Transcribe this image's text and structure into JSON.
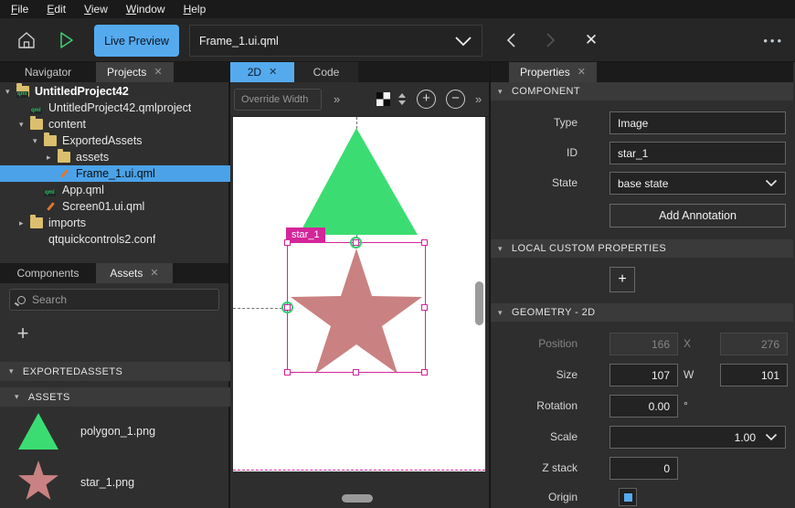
{
  "icons": {
    "caret_down": "▾",
    "caret_right": "▸",
    "close": "✕",
    "chevrons_right": "»",
    "ellipsis": "•••",
    "plus": "+",
    "minus": "−",
    "degree": "°"
  },
  "colors": {
    "accent_blue": "#55aaee",
    "selection_magenta": "#d4259a",
    "triangle_green": "#3bdd72",
    "star_rose": "#ca8181",
    "origin_blue": "#55aaee"
  },
  "menubar": {
    "items": [
      "File",
      "Edit",
      "View",
      "Window",
      "Help"
    ]
  },
  "topbar": {
    "live_preview_label": "Live Preview",
    "open_file": "Frame_1.ui.qml"
  },
  "left": {
    "tabs": {
      "navigator": "Navigator",
      "projects": "Projects"
    },
    "tree": {
      "qml_badge": "qml",
      "items": [
        {
          "label": "UntitledProject42"
        },
        {
          "label": "UntitledProject42.qmlproject"
        },
        {
          "label": "content"
        },
        {
          "label": "ExportedAssets"
        },
        {
          "label": "assets"
        },
        {
          "label": "Frame_1.ui.qml"
        },
        {
          "label": "App.qml"
        },
        {
          "label": "Screen01.ui.qml"
        },
        {
          "label": "imports"
        },
        {
          "label": "qtquickcontrols2.conf"
        }
      ]
    },
    "tabs2": {
      "components": "Components",
      "assets": "Assets"
    },
    "search": {
      "placeholder": "Search"
    },
    "sections": {
      "exported_assets": "EXPORTEDASSETS",
      "assets": "ASSETS"
    },
    "asset_files": [
      {
        "name": "polygon_1.png"
      },
      {
        "name": "star_1.png"
      }
    ]
  },
  "center": {
    "tabs": {
      "two_d": "2D",
      "code": "Code"
    },
    "toolbar": {
      "override_width_placeholder": "Override Width"
    },
    "canvas": {
      "selection_label": "star_1"
    }
  },
  "right": {
    "tab": "Properties",
    "component": {
      "title": "COMPONENT",
      "type_label": "Type",
      "type_value": "Image",
      "id_label": "ID",
      "id_value": "star_1",
      "state_label": "State",
      "state_value": "base state",
      "add_annotation_label": "Add Annotation"
    },
    "local_custom": {
      "title": "LOCAL CUSTOM PROPERTIES"
    },
    "geometry": {
      "title": "GEOMETRY - 2D",
      "position_label": "Position",
      "position_x": "166",
      "position_axis": "X",
      "position_y": "276",
      "size_label": "Size",
      "size_w": "107",
      "size_axis": "W",
      "size_h": "101",
      "rotation_label": "Rotation",
      "rotation_value": "0.00",
      "scale_label": "Scale",
      "scale_value": "1.00",
      "z_label": "Z stack",
      "z_value": "0",
      "origin_label": "Origin"
    }
  }
}
